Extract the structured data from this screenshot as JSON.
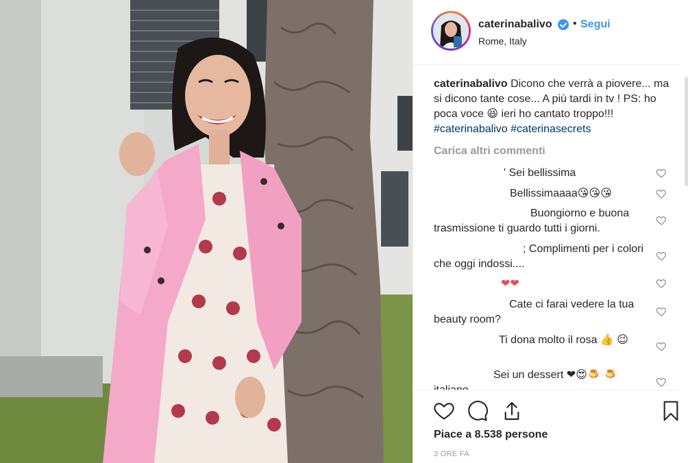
{
  "post": {
    "username": "caterinabalivo",
    "follow_label": "Segui",
    "separator": "•",
    "location": "Rome, Italy",
    "caption_text": "Dicono che verrà a piovere... ma si dicono tante cose... A più tardi in tv ! PS: ho poca voce 😆 ieri ho cantato troppo!!!",
    "hashtags": "#caterinabalivo #caterinasecrets",
    "load_more_label": "Carica altri commenti",
    "likes_prefix": "Piace a",
    "likes_count": "8.538",
    "likes_suffix": "persone",
    "timestamp": "3 ORE FA"
  },
  "comments": [
    {
      "text": "' Sei bellissima"
    },
    {
      "text": "Bellissimaaaa😘😘😘"
    },
    {
      "text": "Buongiorno e buona trasmissione ti guardo tutti i giorni."
    },
    {
      "text": "; Complimenti per i colori che oggi indossi...."
    },
    {
      "text": "❤❤"
    },
    {
      "text": "Cate ci farai vedere la tua beauty room?"
    },
    {
      "text": "Ti dona molto il rosa 👍 😉"
    },
    {
      "text": "Sei un dessert ❤😍🍮 🍮 italiano"
    }
  ],
  "icons": {
    "verified": "verified-badge-icon",
    "like": "heart-icon",
    "comment": "comment-bubble-icon",
    "share": "share-icon",
    "save": "bookmark-icon"
  },
  "colors": {
    "link_blue": "#3897f0",
    "hashtag": "#003569",
    "muted": "#999999",
    "text": "#262626"
  }
}
